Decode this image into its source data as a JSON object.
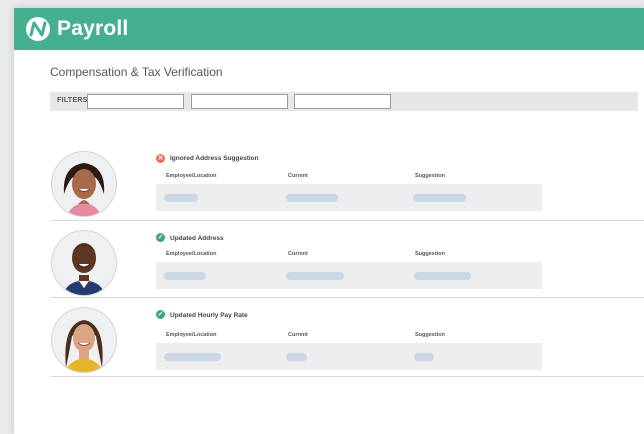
{
  "app": {
    "title": "Payroll"
  },
  "page": {
    "title": "Compensation & Tax Verification"
  },
  "filters": {
    "label": "FILTERS:",
    "inputs": [
      "",
      "",
      ""
    ]
  },
  "columns": {
    "employee": "Employee/Location",
    "current": "Current",
    "suggestion": "Suggestion"
  },
  "records": [
    {
      "status": "error",
      "status_icon": "x-circle-icon",
      "title": "Ignored Address Suggestion"
    },
    {
      "status": "success",
      "status_icon": "check-circle-icon",
      "title": "Updated Address"
    },
    {
      "status": "success",
      "status_icon": "check-circle-icon",
      "title": "Updated Hourly Pay Rate"
    }
  ],
  "colors": {
    "brand": "#44b08f",
    "error": "#e6705f",
    "success": "#3da778",
    "placeholder": "#ccd7e6"
  }
}
